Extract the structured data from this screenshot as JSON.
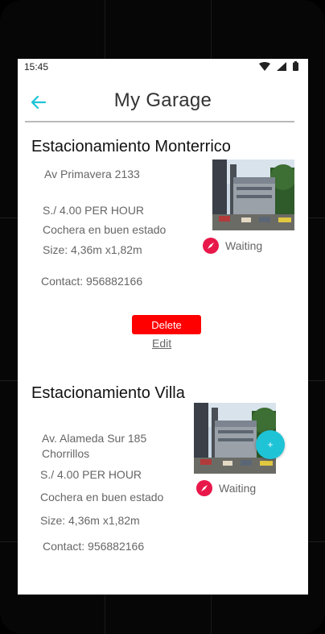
{
  "status_bar": {
    "time": "15:45"
  },
  "header": {
    "title": "My Garage"
  },
  "accent_color": "#1ec3d6",
  "listings": [
    {
      "name": "Estacionamiento Monterrico",
      "address": "Av Primavera 2133",
      "price": "S./ 4.00 PER HOUR",
      "description": "Cochera en buen estado",
      "size": "Size: 4,36m x1,82m",
      "contact": "Contact: 956882166",
      "status": "Waiting",
      "delete_label": "Delete",
      "edit_label": "Edit"
    },
    {
      "name": "Estacionamiento Villa",
      "address_line1": "Av. Alameda Sur 185",
      "address_line2": "Chorrillos",
      "price": "S./ 4.00 PER HOUR",
      "description": "Cochera en buen estado",
      "size": "Size: 4,36m x1,82m",
      "contact": "Contact: 956882166",
      "status": "Waiting"
    }
  ],
  "fab": {
    "label": "+"
  }
}
